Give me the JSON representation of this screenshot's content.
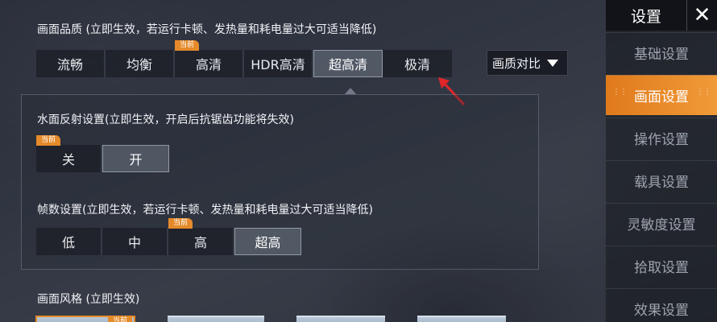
{
  "quality": {
    "title": "画面品质 (立即生效，若运行卡顿、发热量和耗电量过大可适当降低)",
    "options": [
      "流畅",
      "均衡",
      "高清",
      "HDR高清",
      "超高清",
      "极清"
    ],
    "current_badge": "当前",
    "compare_label": "画质对比"
  },
  "water": {
    "title": "水面反射设置(立即生效，开启后抗锯齿功能将失效)",
    "options": [
      "关",
      "开"
    ],
    "current_badge": "当前"
  },
  "fps": {
    "title": "帧数设置(立即生效，若运行卡顿、发热量和耗电量过大可适当降低)",
    "options": [
      "低",
      "中",
      "高",
      "超高"
    ],
    "current_badge": "当前"
  },
  "style": {
    "title": "画面风格 (立即生效)",
    "current_badge": "当前"
  },
  "sidebar": {
    "title": "设置",
    "close": "✕",
    "items": [
      "基础设置",
      "画面设置",
      "操作设置",
      "载具设置",
      "灵敏度设置",
      "拾取设置",
      "效果设置"
    ]
  },
  "colors": {
    "accent": "#e48a2a",
    "annotation_arrow": "#e0262a"
  }
}
